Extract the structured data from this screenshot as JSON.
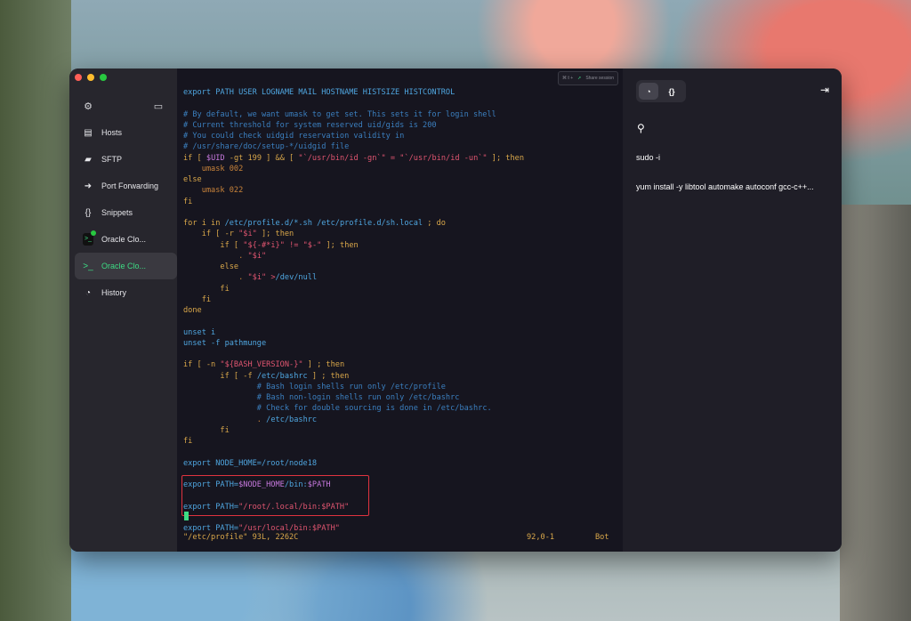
{
  "sidebar": {
    "items": [
      {
        "label": "Hosts",
        "icon": "hosts-icon"
      },
      {
        "label": "SFTP",
        "icon": "folder-icon"
      },
      {
        "label": "Port Forwarding",
        "icon": "port-forward-icon"
      },
      {
        "label": "Snippets",
        "icon": "snippets-icon"
      },
      {
        "label": "Oracle Clo...",
        "icon": "terminal-icon"
      },
      {
        "label": "Oracle Clo...",
        "icon": "terminal-icon"
      },
      {
        "label": "History",
        "icon": "history-icon"
      }
    ]
  },
  "terminal": {
    "share_hint": "⌘⇧+",
    "share_label": "Share session",
    "status_file": "\"/etc/profile\" 93L, 2262C",
    "status_pos": "92,0-1",
    "status_scroll": "Bot"
  },
  "right_panel": {
    "snippets": [
      "sudo -i",
      "yum install -y libtool automake autoconf gcc-c++..."
    ]
  },
  "colors": {
    "accent": "#3ddc84",
    "highlight_border": "#e0333f"
  }
}
